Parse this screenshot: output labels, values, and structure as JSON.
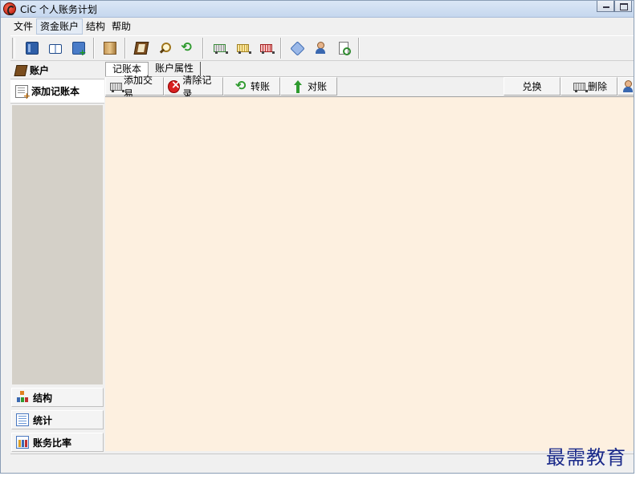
{
  "window": {
    "title": "CiC 个人账务计划"
  },
  "menu": [
    "文件",
    "资金账户",
    "结构",
    "帮助"
  ],
  "toolbar": {
    "icons": [
      "book-icon",
      "open-book-icon",
      "book-add-icon",
      "column-icon",
      "ledger-icon",
      "magnify-icon",
      "cycle-icon",
      "cart-green-icon",
      "cart-gold-icon",
      "cart-red-icon",
      "tag-icon",
      "user-icon",
      "doc-search-icon"
    ]
  },
  "sidebar": {
    "header": "账户",
    "active_item": "添加记账本",
    "bottom_items": [
      "结构",
      "统计",
      "账务比率"
    ]
  },
  "tabs": [
    "记账本",
    "账户属性"
  ],
  "actions": {
    "add_transaction": "添加交易",
    "clear_records": "清除记录",
    "transfer": "转账",
    "reconcile": "对账",
    "exchange": "兑换",
    "delete": "删除"
  },
  "watermark": "最需教育"
}
